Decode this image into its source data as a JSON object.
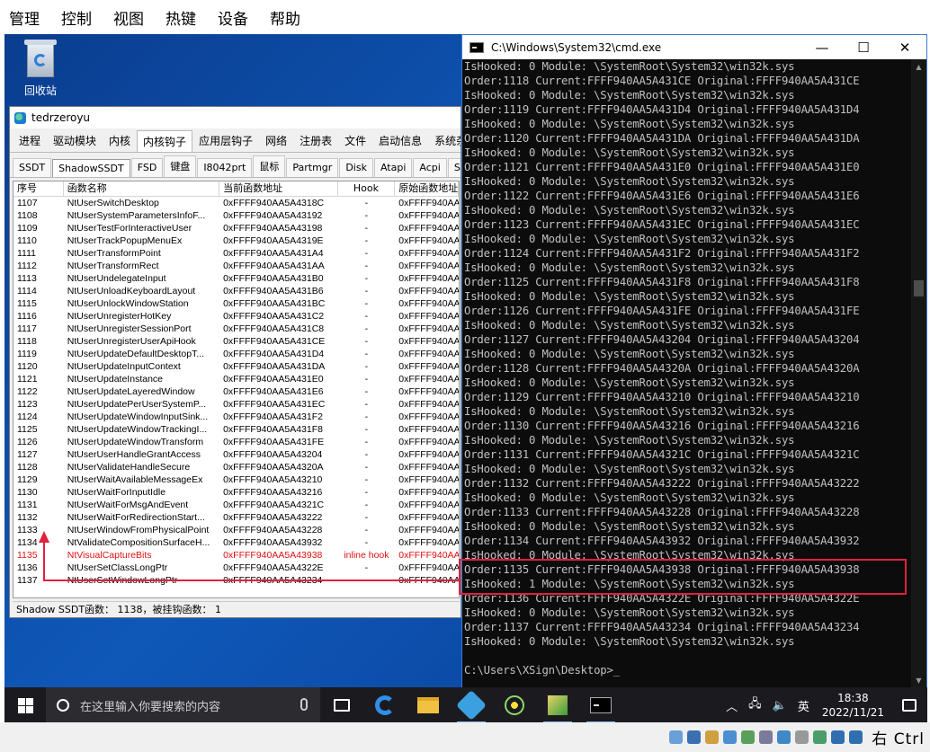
{
  "vm_menu": [
    "管理",
    "控制",
    "视图",
    "热键",
    "设备",
    "帮助"
  ],
  "desktop": {
    "recycle_bin_label": "回收站"
  },
  "tool_window": {
    "title": "tedrzeroyu",
    "main_tabs": [
      "进程",
      "驱动模块",
      "内核",
      "内核钩子",
      "应用层钩子",
      "网络",
      "注册表",
      "文件",
      "启动信息",
      "系统杂"
    ],
    "active_main_tab": 3,
    "sub_tabs": [
      "SSDT",
      "ShadowSSDT",
      "FSD",
      "键盘",
      "I8042prt",
      "鼠标",
      "Partmgr",
      "Disk",
      "Atapi",
      "Acpi",
      "Scsi"
    ],
    "active_sub_tab": 1,
    "columns": [
      "序号",
      "函数名称",
      "当前函数地址",
      "Hook",
      "原始函数地址"
    ],
    "rows": [
      [
        "1107",
        "NtUserSwitchDesktop",
        "0xFFFF940AA5A4318C",
        "-",
        "0xFFFF940AA"
      ],
      [
        "1108",
        "NtUserSystemParametersInfoF...",
        "0xFFFF940AA5A43192",
        "-",
        "0xFFFF940AA"
      ],
      [
        "1109",
        "NtUserTestForInteractiveUser",
        "0xFFFF940AA5A43198",
        "-",
        "0xFFFF940AA"
      ],
      [
        "1110",
        "NtUserTrackPopupMenuEx",
        "0xFFFF940AA5A4319E",
        "-",
        "0xFFFF940AA"
      ],
      [
        "1111",
        "NtUserTransformPoint",
        "0xFFFF940AA5A431A4",
        "-",
        "0xFFFF940AA"
      ],
      [
        "1112",
        "NtUserTransformRect",
        "0xFFFF940AA5A431AA",
        "-",
        "0xFFFF940AA"
      ],
      [
        "1113",
        "NtUserUndelegateInput",
        "0xFFFF940AA5A431B0",
        "-",
        "0xFFFF940AA"
      ],
      [
        "1114",
        "NtUserUnloadKeyboardLayout",
        "0xFFFF940AA5A431B6",
        "-",
        "0xFFFF940AA"
      ],
      [
        "1115",
        "NtUserUnlockWindowStation",
        "0xFFFF940AA5A431BC",
        "-",
        "0xFFFF940AA"
      ],
      [
        "1116",
        "NtUserUnregisterHotKey",
        "0xFFFF940AA5A431C2",
        "-",
        "0xFFFF940AA"
      ],
      [
        "1117",
        "NtUserUnregisterSessionPort",
        "0xFFFF940AA5A431C8",
        "-",
        "0xFFFF940AA"
      ],
      [
        "1118",
        "NtUserUnregisterUserApiHook",
        "0xFFFF940AA5A431CE",
        "-",
        "0xFFFF940AA"
      ],
      [
        "1119",
        "NtUserUpdateDefaultDesktopT...",
        "0xFFFF940AA5A431D4",
        "-",
        "0xFFFF940AA"
      ],
      [
        "1120",
        "NtUserUpdateInputContext",
        "0xFFFF940AA5A431DA",
        "-",
        "0xFFFF940AA"
      ],
      [
        "1121",
        "NtUserUpdateInstance",
        "0xFFFF940AA5A431E0",
        "-",
        "0xFFFF940AA"
      ],
      [
        "1122",
        "NtUserUpdateLayeredWindow",
        "0xFFFF940AA5A431E6",
        "-",
        "0xFFFF940AA"
      ],
      [
        "1123",
        "NtUserUpdatePerUserSystemP...",
        "0xFFFF940AA5A431EC",
        "-",
        "0xFFFF940AA"
      ],
      [
        "1124",
        "NtUserUpdateWindowInputSink...",
        "0xFFFF940AA5A431F2",
        "-",
        "0xFFFF940AA"
      ],
      [
        "1125",
        "NtUserUpdateWindowTrackingI...",
        "0xFFFF940AA5A431F8",
        "-",
        "0xFFFF940AA"
      ],
      [
        "1126",
        "NtUserUpdateWindowTransform",
        "0xFFFF940AA5A431FE",
        "-",
        "0xFFFF940AA"
      ],
      [
        "1127",
        "NtUserUserHandleGrantAccess",
        "0xFFFF940AA5A43204",
        "-",
        "0xFFFF940AA"
      ],
      [
        "1128",
        "NtUserValidateHandleSecure",
        "0xFFFF940AA5A4320A",
        "-",
        "0xFFFF940AA"
      ],
      [
        "1129",
        "NtUserWaitAvailableMessageEx",
        "0xFFFF940AA5A43210",
        "-",
        "0xFFFF940AA"
      ],
      [
        "1130",
        "NtUserWaitForInputIdle",
        "0xFFFF940AA5A43216",
        "-",
        "0xFFFF940AA"
      ],
      [
        "1131",
        "NtUserWaitForMsgAndEvent",
        "0xFFFF940AA5A4321C",
        "-",
        "0xFFFF940AA"
      ],
      [
        "1132",
        "NtUserWaitForRedirectionStart...",
        "0xFFFF940AA5A43222",
        "-",
        "0xFFFF940AA"
      ],
      [
        "1133",
        "NtUserWindowFromPhysicalPoint",
        "0xFFFF940AA5A43228",
        "-",
        "0xFFFF940AA"
      ],
      [
        "1134",
        "NtValidateCompositionSurfaceH...",
        "0xFFFF940AA5A43932",
        "-",
        "0xFFFF940AA"
      ],
      [
        "1135",
        "NtVisualCaptureBits",
        "0xFFFF940AA5A43938",
        "inline hook",
        "0xFFFF940AA"
      ],
      [
        "1136",
        "NtUserSetClassLongPtr",
        "0xFFFF940AA5A4322E",
        "-",
        "0xFFFF940AA"
      ],
      [
        "1137",
        "NtUserSetWindowLongPtr",
        "0xFFFF940AA5A43234",
        "-",
        "0xFFFF940AA"
      ]
    ],
    "hooked_row_index": 28,
    "status": "Shadow SSDT函数： 1138，被挂钩函数： 1"
  },
  "cmd_window": {
    "title": "C:\\Windows\\System32\\cmd.exe",
    "lines": [
      "IsHooked: 0 Module: \\SystemRoot\\System32\\win32k.sys",
      "Order:1118 Current:FFFF940AA5A431CE Original:FFFF940AA5A431CE",
      "IsHooked: 0 Module: \\SystemRoot\\System32\\win32k.sys",
      "Order:1119 Current:FFFF940AA5A431D4 Original:FFFF940AA5A431D4",
      "IsHooked: 0 Module: \\SystemRoot\\System32\\win32k.sys",
      "Order:1120 Current:FFFF940AA5A431DA Original:FFFF940AA5A431DA",
      "IsHooked: 0 Module: \\SystemRoot\\System32\\win32k.sys",
      "Order:1121 Current:FFFF940AA5A431E0 Original:FFFF940AA5A431E0",
      "IsHooked: 0 Module: \\SystemRoot\\System32\\win32k.sys",
      "Order:1122 Current:FFFF940AA5A431E6 Original:FFFF940AA5A431E6",
      "IsHooked: 0 Module: \\SystemRoot\\System32\\win32k.sys",
      "Order:1123 Current:FFFF940AA5A431EC Original:FFFF940AA5A431EC",
      "IsHooked: 0 Module: \\SystemRoot\\System32\\win32k.sys",
      "Order:1124 Current:FFFF940AA5A431F2 Original:FFFF940AA5A431F2",
      "IsHooked: 0 Module: \\SystemRoot\\System32\\win32k.sys",
      "Order:1125 Current:FFFF940AA5A431F8 Original:FFFF940AA5A431F8",
      "IsHooked: 0 Module: \\SystemRoot\\System32\\win32k.sys",
      "Order:1126 Current:FFFF940AA5A431FE Original:FFFF940AA5A431FE",
      "IsHooked: 0 Module: \\SystemRoot\\System32\\win32k.sys",
      "Order:1127 Current:FFFF940AA5A43204 Original:FFFF940AA5A43204",
      "IsHooked: 0 Module: \\SystemRoot\\System32\\win32k.sys",
      "Order:1128 Current:FFFF940AA5A4320A Original:FFFF940AA5A4320A",
      "IsHooked: 0 Module: \\SystemRoot\\System32\\win32k.sys",
      "Order:1129 Current:FFFF940AA5A43210 Original:FFFF940AA5A43210",
      "IsHooked: 0 Module: \\SystemRoot\\System32\\win32k.sys",
      "Order:1130 Current:FFFF940AA5A43216 Original:FFFF940AA5A43216",
      "IsHooked: 0 Module: \\SystemRoot\\System32\\win32k.sys",
      "Order:1131 Current:FFFF940AA5A4321C Original:FFFF940AA5A4321C",
      "IsHooked: 0 Module: \\SystemRoot\\System32\\win32k.sys",
      "Order:1132 Current:FFFF940AA5A43222 Original:FFFF940AA5A43222",
      "IsHooked: 0 Module: \\SystemRoot\\System32\\win32k.sys",
      "Order:1133 Current:FFFF940AA5A43228 Original:FFFF940AA5A43228",
      "IsHooked: 0 Module: \\SystemRoot\\System32\\win32k.sys",
      "Order:1134 Current:FFFF940AA5A43932 Original:FFFF940AA5A43932",
      "IsHooked: 0 Module: \\SystemRoot\\System32\\win32k.sys",
      "Order:1135 Current:FFFF940AA5A43938 Original:FFFF940AA5A43938",
      "IsHooked: 1 Module: \\SystemRoot\\System32\\win32k.sys",
      "Order:1136 Current:FFFF940AA5A4322E Original:FFFF940AA5A4322E",
      "IsHooked: 0 Module: \\SystemRoot\\System32\\win32k.sys",
      "Order:1137 Current:FFFF940AA5A43234 Original:FFFF940AA5A43234",
      "IsHooked: 0 Module: \\SystemRoot\\System32\\win32k.sys",
      "",
      "C:\\Users\\XSign\\Desktop>_"
    ]
  },
  "taskbar": {
    "search_placeholder": "在这里输入你要搜索的内容",
    "ime_label": "英",
    "time": "18:38",
    "date": "2022/11/21"
  },
  "vm_statusbar": {
    "host_key": "右 Ctrl"
  },
  "colors": {
    "highlight": "#e02040",
    "hooked_text": "#e01010",
    "desktop_bg": "#0f58b8",
    "console_bg": "#0c0c0c"
  }
}
